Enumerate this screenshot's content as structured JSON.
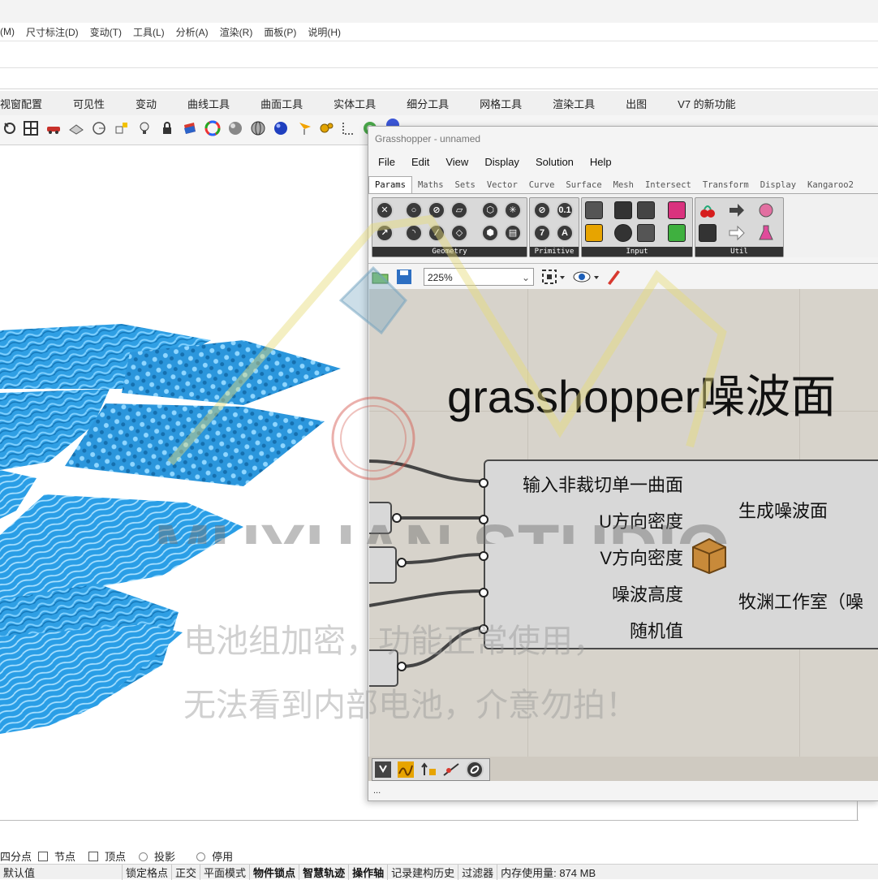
{
  "rhino": {
    "menus": [
      "(M)",
      "尺寸标注(D)",
      "变动(T)",
      "工具(L)",
      "分析(A)",
      "渲染(R)",
      "面板(P)",
      "说明(H)"
    ],
    "tabs": [
      "视窗配置",
      "可见性",
      "变动",
      "曲线工具",
      "曲面工具",
      "实体工具",
      "细分工具",
      "网格工具",
      "渲染工具",
      "出图",
      "V7 的新功能"
    ],
    "toolbar_icons": [
      "rotate-view-icon",
      "four-viewports-icon",
      "car-icon",
      "layer-icon",
      "circle-icon",
      "snap-icon",
      "light-bulb-icon",
      "lock-icon",
      "material-icon",
      "color-wheel-icon",
      "shaded-sphere-icon",
      "wireframe-sphere-icon",
      "render-sphere-icon",
      "flag-icon",
      "gear-cluster-icon",
      "dimension-icon",
      "grasshopper-icon",
      "help-icon"
    ],
    "snaps": {
      "quad": "四分点",
      "knot": "节点",
      "vertex": "顶点",
      "project": "投影",
      "disable": "停用"
    },
    "status": {
      "default": "默认值",
      "grid_snap": "锁定格点",
      "ortho": "正交",
      "planar": "平面模式",
      "osnap": "物件锁点",
      "smarttrack": "智慧轨迹",
      "gumball": "操作轴",
      "history": "记录建构历史",
      "filter": "过滤器",
      "memory": "内存使用量: 874 MB"
    }
  },
  "gh": {
    "title": "Grasshopper - unnamed",
    "menu": [
      "File",
      "Edit",
      "View",
      "Display",
      "Solution",
      "Help"
    ],
    "tabs": [
      "Params",
      "Maths",
      "Sets",
      "Vector",
      "Curve",
      "Surface",
      "Mesh",
      "Intersect",
      "Transform",
      "Display",
      "Kangaroo2"
    ],
    "active_tab": "Params",
    "groups": [
      "Geometry",
      "Primitive",
      "Input",
      "Util"
    ],
    "zoom": "225%",
    "canvas_title": "grasshopper噪波面",
    "inputs": [
      "输入非裁切单一曲面",
      "U方向密度",
      "V方向密度",
      "噪波高度",
      "随机值"
    ],
    "outputs": [
      "生成噪波面",
      "牧渊工作室（噪"
    ],
    "status_text": "..."
  },
  "watermark": {
    "logo": "MUYUAN STUDIO",
    "line1": "电池组加密，功能正常使用，",
    "line2": "无法看到内部电池，介意勿拍！"
  },
  "colors": {
    "surface_blue": "#2a9ee6",
    "canvas_bg": "#d7d3cb",
    "component_bg": "#d8d8d8"
  }
}
